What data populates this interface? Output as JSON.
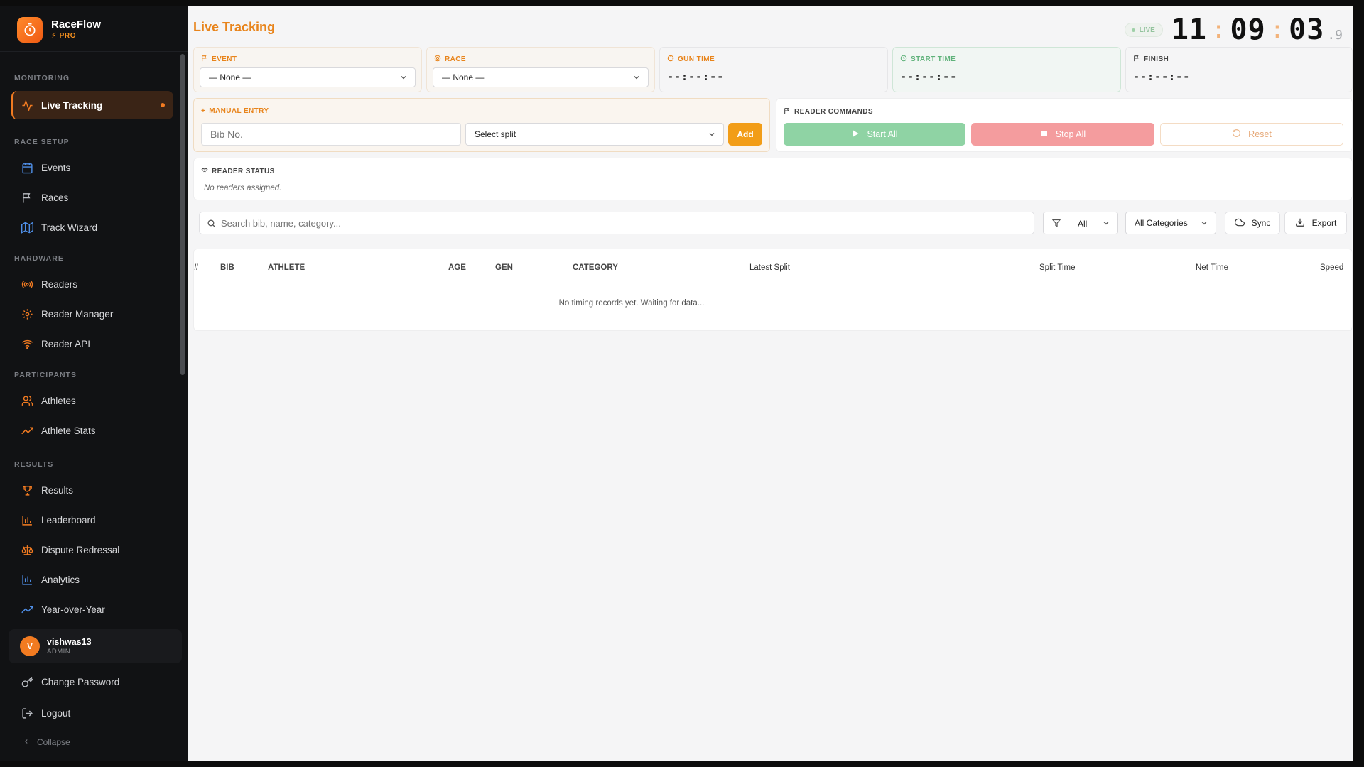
{
  "brand": {
    "name": "RaceFlow",
    "tier": "PRO"
  },
  "sidebar": {
    "sections": [
      {
        "label": "MONITORING",
        "items": [
          {
            "label": "Live Tracking",
            "icon": "activity-icon",
            "active": true
          }
        ]
      },
      {
        "label": "RACE SETUP",
        "items": [
          {
            "label": "Events",
            "icon": "calendar-icon"
          },
          {
            "label": "Races",
            "icon": "flag-icon"
          },
          {
            "label": "Track Wizard",
            "icon": "map-icon"
          }
        ]
      },
      {
        "label": "HARDWARE",
        "items": [
          {
            "label": "Readers",
            "icon": "radio-icon"
          },
          {
            "label": "Reader Manager",
            "icon": "gear-icon"
          },
          {
            "label": "Reader API",
            "icon": "wifi-icon"
          }
        ]
      },
      {
        "label": "PARTICIPANTS",
        "items": [
          {
            "label": "Athletes",
            "icon": "users-icon"
          },
          {
            "label": "Athlete Stats",
            "icon": "trending-icon"
          }
        ]
      },
      {
        "label": "RESULTS",
        "items": [
          {
            "label": "Results",
            "icon": "trophy-icon"
          },
          {
            "label": "Leaderboard",
            "icon": "bar-chart-icon"
          },
          {
            "label": "Dispute Redressal",
            "icon": "scale-icon"
          },
          {
            "label": "Analytics",
            "icon": "analytics-icon"
          },
          {
            "label": "Year-over-Year",
            "icon": "trend-up-icon"
          }
        ]
      }
    ],
    "user": {
      "initial": "V",
      "name": "vishwas13",
      "role": "ADMIN"
    },
    "change_password": "Change Password",
    "logout": "Logout",
    "collapse": "Collapse"
  },
  "header": {
    "title": "Live Tracking",
    "live": "LIVE",
    "clock": {
      "hh": "11",
      "mm": "09",
      "ss": "03",
      "tenth": ".9"
    }
  },
  "cards": {
    "event": {
      "label": "EVENT",
      "value": "— None —"
    },
    "race": {
      "label": "RACE",
      "value": "— None —"
    },
    "gun_time": {
      "label": "GUN TIME",
      "value": "--:--:--"
    },
    "start_time": {
      "label": "START TIME",
      "value": "--:--:--"
    },
    "finish": {
      "label": "FINISH",
      "value": "--:--:--"
    }
  },
  "manual_entry": {
    "label": "MANUAL ENTRY",
    "bib_placeholder": "Bib No.",
    "split_placeholder": "Select split",
    "add": "Add"
  },
  "reader_commands": {
    "label": "READER COMMANDS",
    "start_all": "Start All",
    "stop_all": "Stop All",
    "reset": "Reset"
  },
  "reader_status": {
    "label": "READER STATUS",
    "message": "No readers assigned."
  },
  "filters": {
    "search_placeholder": "Search bib, name, category...",
    "status": "All",
    "category": "All Categories",
    "sync": "Sync",
    "export": "Export"
  },
  "table": {
    "columns": [
      "#",
      "BIB",
      "ATHLETE",
      "AGE",
      "GEN",
      "CATEGORY",
      "Latest Split",
      "Split Time",
      "Net Time",
      "Speed"
    ],
    "empty": "No timing records yet. Waiting for data..."
  },
  "colors": {
    "accent": "#f27b21",
    "title": "#e8841b",
    "start": "#8fd3a4",
    "stop": "#f49c9e"
  }
}
